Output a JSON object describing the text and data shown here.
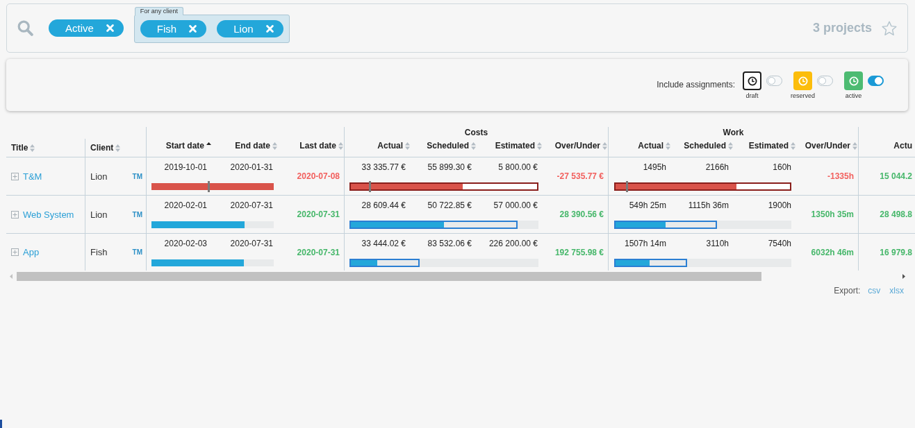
{
  "filters": {
    "chips": [
      {
        "label": "Active"
      }
    ],
    "groups": [
      {
        "title": "For any client",
        "chips": [
          {
            "label": "Fish"
          },
          {
            "label": "Lion"
          }
        ]
      }
    ],
    "count": "3 projects",
    "starred": false
  },
  "assignments": {
    "label": "Include assignments:",
    "items": [
      {
        "label": "draft",
        "kind": "outline",
        "color": "#1e1e1e",
        "on": false
      },
      {
        "label": "reserved",
        "kind": "filled",
        "color": "#fcbd0b",
        "on": false
      },
      {
        "label": "active",
        "kind": "filled",
        "color": "#4dbb72",
        "on": true
      }
    ]
  },
  "table": {
    "groups": [
      {
        "label": "Costs"
      },
      {
        "label": "Work"
      }
    ],
    "columns": [
      {
        "label": "Title",
        "sorted": false
      },
      {
        "label": "Client",
        "sorted": false
      },
      {
        "label": "Start date",
        "sorted": true
      },
      {
        "label": "End date",
        "sorted": false
      },
      {
        "label": "Last date",
        "sorted": false
      },
      {
        "label": "Actual",
        "sorted": false
      },
      {
        "label": "Scheduled",
        "sorted": false
      },
      {
        "label": "Estimated",
        "sorted": false
      },
      {
        "label": "Over/Under",
        "sorted": false
      },
      {
        "label": "Actual",
        "sorted": false
      },
      {
        "label": "Scheduled",
        "sorted": false
      },
      {
        "label": "Estimated",
        "sorted": false
      },
      {
        "label": "Over/Under",
        "sorted": false
      },
      {
        "label": "Actu"
      }
    ],
    "rows": [
      {
        "title": "T&M",
        "expanded": false,
        "client": "Lion",
        "manager": "TM",
        "start_date": "2019-10-01",
        "end_date": "2020-01-31",
        "last_date": "2020-07-08",
        "late": true,
        "date_bar": {
          "marker": {
            "level": 0.47
          }
        },
        "costs": {
          "actual": "33 335.77 €",
          "scheduled": "55 899.30 €",
          "estimated": "5 800.00 €",
          "over_under": "-27 535.77 €",
          "over": true,
          "bar": {
            "fill": {
              "level": 0.6
            },
            "marker": {
              "level": 0.107
            }
          }
        },
        "work": {
          "actual": "1495h",
          "scheduled": "2166h",
          "estimated": "160h",
          "over_under": "-1335h",
          "over": true,
          "bar": {
            "fill": {
              "level": 0.69
            },
            "marker": {
              "level": 0.074
            }
          }
        },
        "column_14": "15 044.2"
      },
      {
        "title": "Web System",
        "expanded": false,
        "client": "Lion",
        "manager": "TM",
        "start_date": "2020-02-01",
        "end_date": "2020-07-31",
        "last_date": "2020-07-31",
        "late": false,
        "date_bar": {
          "fill": {
            "level": 0.76
          }
        },
        "costs": {
          "actual": "28 609.44 €",
          "scheduled": "50 722.85 €",
          "estimated": "57 000.00 €",
          "over_under": "28 390.56 €",
          "over": false,
          "bar": {
            "frame": {
              "level": 0.89
            },
            "fill": {
              "level": 0.5
            }
          }
        },
        "work": {
          "actual": "549h 25m",
          "scheduled": "1115h 36m",
          "estimated": "1900h",
          "over_under": "1350h 35m",
          "over": false,
          "bar": {
            "frame": {
              "level": 0.58
            },
            "fill": {
              "level": 0.29
            }
          }
        },
        "column_14": "28 498.8"
      },
      {
        "title": "App",
        "expanded": false,
        "client": "Fish",
        "manager": "TM",
        "start_date": "2020-02-03",
        "end_date": "2020-07-31",
        "last_date": "2020-07-31",
        "late": false,
        "date_bar": {
          "fill": {
            "level": 0.755
          }
        },
        "costs": {
          "actual": "33 444.02 €",
          "scheduled": "83 532.06 €",
          "estimated": "226 200.00 €",
          "over_under": "192 755.98 €",
          "over": false,
          "bar": {
            "frame": {
              "level": 0.37
            },
            "fill": {
              "level": 0.148
            }
          }
        },
        "work": {
          "actual": "1507h 14m",
          "scheduled": "3110h",
          "estimated": "7540h",
          "over_under": "6032h 46m",
          "over": false,
          "bar": {
            "frame": {
              "level": 0.41
            },
            "fill": {
              "level": 0.2
            }
          }
        },
        "column_14": "16 979.8"
      }
    ]
  },
  "export": {
    "label": "Export:",
    "formats": [
      "csv",
      "xlsx"
    ]
  }
}
